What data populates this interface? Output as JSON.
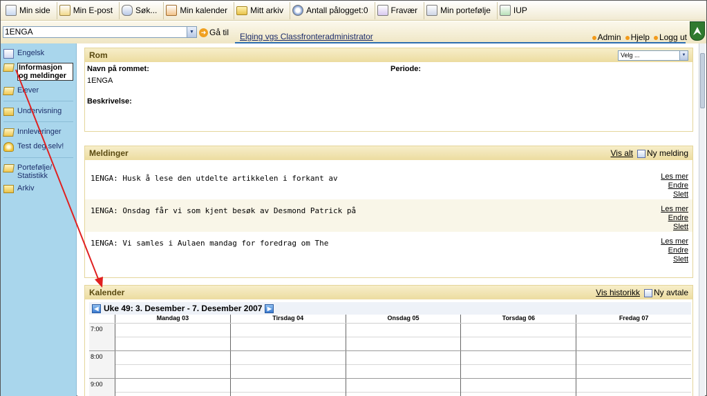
{
  "toolbar": {
    "items": [
      {
        "label": "Min side",
        "icon": "home-icon"
      },
      {
        "label": "Min E-post",
        "icon": "mail-icon"
      },
      {
        "label": "Søk...",
        "icon": "people-search-icon"
      },
      {
        "label": "Min kalender",
        "icon": "calendar-icon"
      },
      {
        "label": "Mitt arkiv",
        "icon": "folder-icon"
      },
      {
        "label": "Antall pålogget:0",
        "icon": "online-icon"
      },
      {
        "label": "Fravær",
        "icon": "absence-icon"
      },
      {
        "label": "Min portefølje",
        "icon": "portfolio-icon"
      },
      {
        "label": "IUP",
        "icon": "iup-icon"
      }
    ]
  },
  "header": {
    "room_value": "1ENGA",
    "goto_label": "Gå til",
    "school_link": "Elging vgs Classfronteradministrator",
    "links": [
      "Admin",
      "Hjelp",
      "Logg ut"
    ]
  },
  "sidebar": {
    "items": [
      {
        "label": "Engelsk",
        "icon": "document-icon"
      },
      {
        "label": "Informasjon og meldinger",
        "icon": "folder-open-icon",
        "active": true
      },
      {
        "label": "Elever",
        "icon": "folder-open-icon"
      },
      {
        "label": "Undervisning",
        "icon": "folder-icon"
      },
      {
        "label": "Innleveringer",
        "icon": "folder-open-icon"
      },
      {
        "label": "Test deg selv!",
        "icon": "lightbulb-icon"
      },
      {
        "label": "Portefølje/ Statistikk",
        "icon": "folder-open-icon"
      },
      {
        "label": "Arkiv",
        "icon": "folder-icon"
      }
    ]
  },
  "rom": {
    "title": "Rom",
    "select_label": "Velg ...",
    "name_label": "Navn på rommet:",
    "name_value": "1ENGA",
    "period_label": "Periode:",
    "desc_label": "Beskrivelse:"
  },
  "meldinger": {
    "title": "Meldinger",
    "show_all": "Vis alt",
    "new_label": "Ny melding",
    "read_more": "Les mer",
    "edit": "Endre",
    "delete": "Slett",
    "messages": [
      "1ENGA: Husk å lese den utdelte artikkelen i forkant av",
      "1ENGA: Onsdag får vi som kjent besøk av Desmond Patrick på",
      "1ENGA: Vi samles i Aulaen mandag for foredrag om The"
    ]
  },
  "kalender": {
    "title": "Kalender",
    "history": "Vis historikk",
    "new_label": "Ny avtale",
    "week_label": "Uke 49: 3. Desember - 7. Desember 2007",
    "days": [
      "Mandag 03",
      "Tirsdag 04",
      "Onsdag 05",
      "Torsdag 06",
      "Fredag 07"
    ],
    "hours": [
      "7:00",
      "8:00",
      "9:00"
    ]
  },
  "colors": {
    "sidebar_bg": "#a9d6ec",
    "panel_header": "#ecdca0",
    "annotation_arrow": "#e02020"
  }
}
